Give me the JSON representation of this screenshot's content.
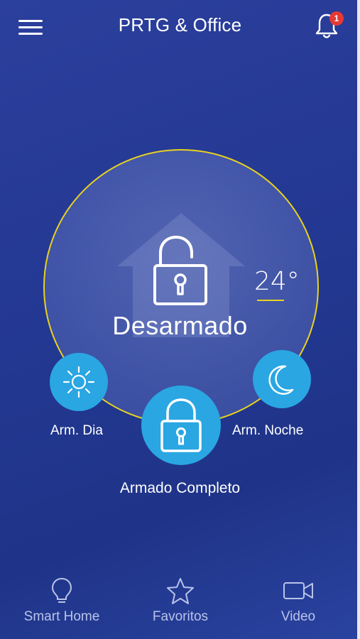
{
  "header": {
    "title": "PRTG & Office",
    "notification_count": "1",
    "menu_icon": "hamburger-menu-icon",
    "bell_icon": "bell-icon"
  },
  "status_panel": {
    "status_text": "Desarmado",
    "temperature": "24°",
    "lock_icon": "open-padlock-icon",
    "background_icon": "house-icon",
    "ring_color": "#e9d21f"
  },
  "modes": {
    "day": {
      "label": "Arm. Dia",
      "icon": "sun-icon"
    },
    "night": {
      "label": "Arm. Noche",
      "icon": "moon-icon"
    },
    "full": {
      "label": "Armado Completo",
      "icon": "closed-padlock-icon"
    },
    "button_color": "#2aa6e2"
  },
  "bottom_nav": [
    {
      "label": "Smart Home",
      "icon": "lightbulb-icon"
    },
    {
      "label": "Favoritos",
      "icon": "star-icon"
    },
    {
      "label": "Video",
      "icon": "video-camera-icon"
    }
  ],
  "colors": {
    "background": "#2438940",
    "badge": "#e53935"
  }
}
